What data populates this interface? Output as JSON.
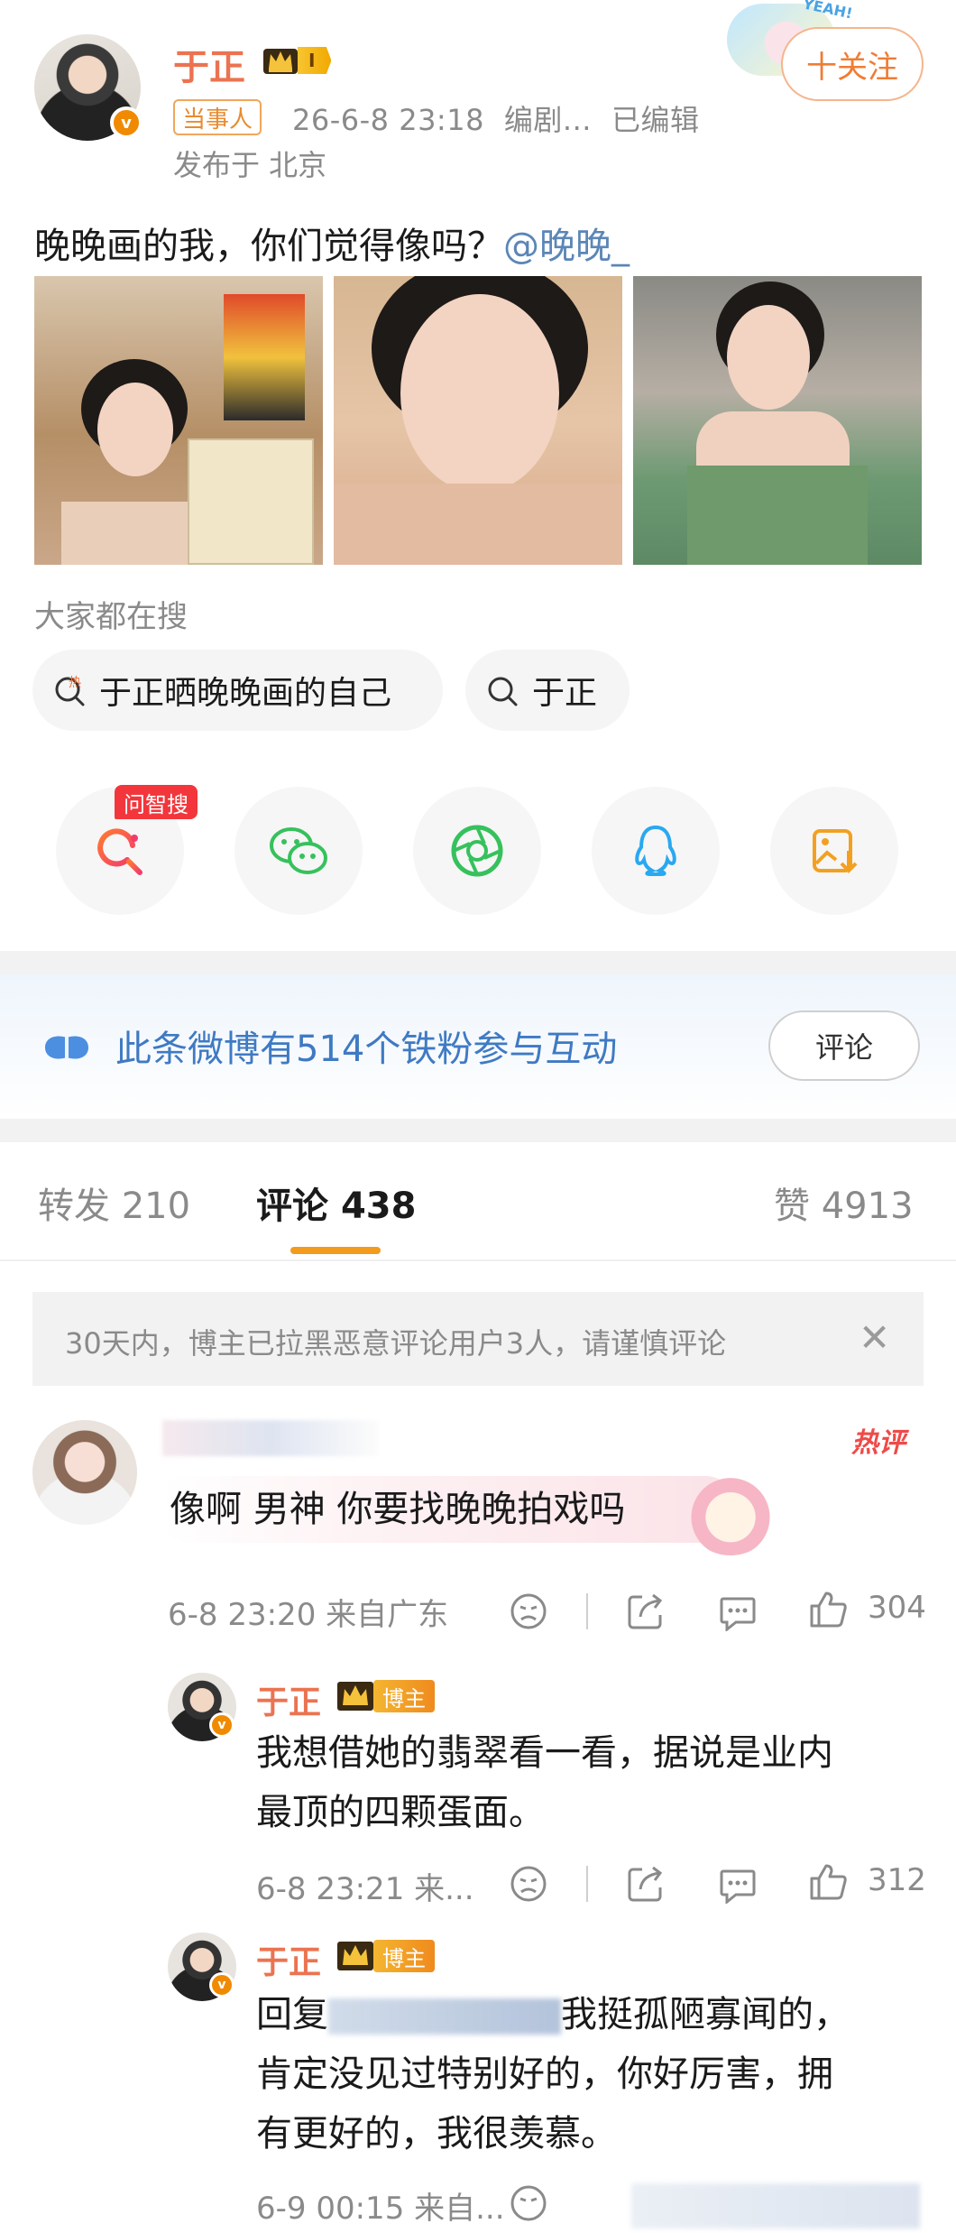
{
  "post": {
    "author": "于正",
    "level": "I",
    "follow_label": "十关注",
    "tag": "当事人",
    "time": "26-6-8 23:18",
    "source": "编剧...",
    "edited": "已编辑",
    "location": "发布于 北京",
    "text": "晚晚画的我，你们觉得像吗？",
    "mention": "@晚晚_",
    "sticker_text": "YEAH!"
  },
  "search": {
    "title": "大家都在搜",
    "chips": [
      "于正晒晚晚画的自己",
      "于正"
    ],
    "hot_mark": "热"
  },
  "share": {
    "ask_badge": "问智搜",
    "items": [
      "wenzhisou-icon",
      "wechat-icon",
      "moments-icon",
      "qq-icon",
      "save-image-icon"
    ]
  },
  "fans_banner": {
    "text": "此条微博有514个铁粉参与互动",
    "button": "评论"
  },
  "tabs": {
    "repost_label": "转发",
    "repost_count": "210",
    "comment_label": "评论",
    "comment_count": "438",
    "like_label": "赞",
    "like_count": "4913"
  },
  "notice": "30天内，博主已拉黑恶意评论用户3人，请谨慎评论",
  "comments": [
    {
      "hot_tag": "热评",
      "text": "像啊 男神 你要找晚晚拍戏吗",
      "time": "6-8 23:20 来自广东",
      "likes": "304"
    }
  ],
  "replies": [
    {
      "name": "于正",
      "host_tag": "博主",
      "line1": "我想借她的翡翠看一看，据说是业内",
      "line2": "最顶的四颗蛋面。",
      "time": "6-8 23:21 来...",
      "likes": "312"
    },
    {
      "name": "于正",
      "host_tag": "博主",
      "line1_prefix": "回复",
      "line1": "我挺孤陋寡闻的，",
      "line2": "肯定没见过特别好的，你好厉害，拥",
      "line3": "有更好的，我很羡慕。",
      "time": "6-9 00:15 来自..."
    }
  ],
  "colors": {
    "accent_orange": "#eb7350",
    "link_blue": "#5b86b7",
    "tab_indicator": "#f39b1c",
    "hot_red": "#ef4a49"
  }
}
